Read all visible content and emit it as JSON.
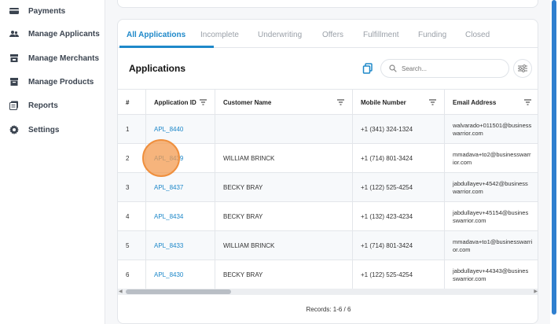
{
  "sidebar": {
    "items": [
      {
        "label": "Payments",
        "icon": "credit-card-icon"
      },
      {
        "label": "Manage Applicants",
        "icon": "users-icon"
      },
      {
        "label": "Manage Merchants",
        "icon": "store-icon"
      },
      {
        "label": "Manage Products",
        "icon": "box-icon"
      },
      {
        "label": "Reports",
        "icon": "reports-icon"
      },
      {
        "label": "Settings",
        "icon": "gear-icon"
      }
    ]
  },
  "tabs": [
    {
      "label": "All Applications",
      "active": true
    },
    {
      "label": "Incomplete"
    },
    {
      "label": "Underwriting"
    },
    {
      "label": "Offers"
    },
    {
      "label": "Fulfillment"
    },
    {
      "label": "Funding"
    },
    {
      "label": "Closed"
    }
  ],
  "list": {
    "title": "Applications",
    "search_placeholder": "Search..."
  },
  "table": {
    "columns": [
      "#",
      "Application ID",
      "Customer Name",
      "Mobile Number",
      "Email Address"
    ],
    "rows": [
      {
        "n": "1",
        "id": "APL_8440",
        "name": "",
        "mobile": "+1 (341) 324-1324",
        "email": "walvarado+011501@business warrior.com"
      },
      {
        "n": "2",
        "id": "APL_8439",
        "name": "WILLIAM BRINCK",
        "mobile": "+1 (714) 801-3424",
        "email": "mmadava+to2@businesswarr ior.com"
      },
      {
        "n": "3",
        "id": "APL_8437",
        "name": "BECKY BRAY",
        "mobile": "+1 (122) 525-4254",
        "email": "jabdullayev+4542@business warrior.com"
      },
      {
        "n": "4",
        "id": "APL_8434",
        "name": "BECKY BRAY",
        "mobile": "+1 (132) 423-4234",
        "email": "jabdullayev+45154@busines swarrior.com"
      },
      {
        "n": "5",
        "id": "APL_8433",
        "name": "WILLIAM BRINCK",
        "mobile": "+1 (714) 801-3424",
        "email": "mmadava+to1@businesswarri or.com"
      },
      {
        "n": "6",
        "id": "APL_8430",
        "name": "BECKY BRAY",
        "mobile": "+1 (122) 525-4254",
        "email": "jabdullayev+44343@busines swarrior.com"
      }
    ]
  },
  "records": "Records: 1-6 / 6",
  "colors": {
    "accent": "#1e88c9",
    "highlight": "#ef8f3d"
  }
}
